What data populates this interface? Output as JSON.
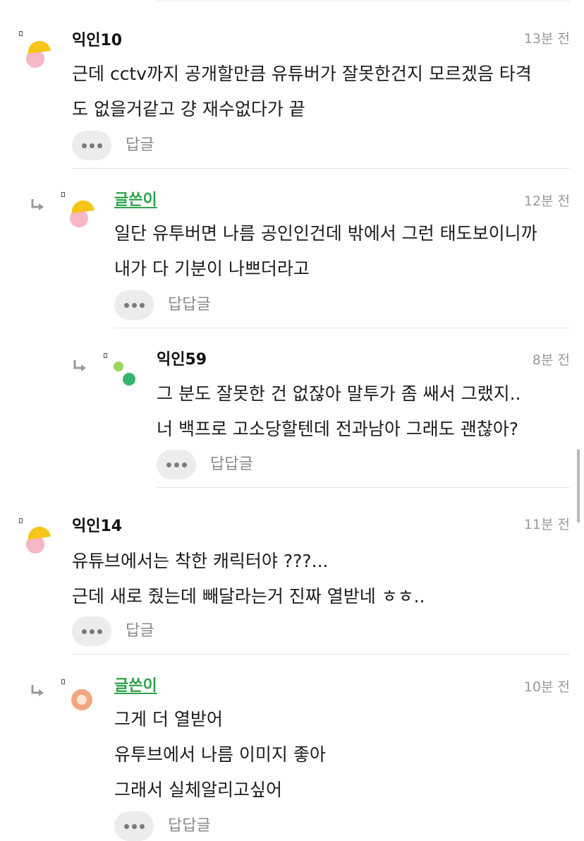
{
  "comments": [
    {
      "author": "익인10",
      "time": "13분 전",
      "lines": [
        "근데 cctv까지 공개할만큼 유튜버가 잘못한건지 모르겠음 타격",
        "도 없을거같고 걍 재수없다가 끝"
      ],
      "reply_label": "답글"
    },
    {
      "author": "글쓴이",
      "time": "12분 전",
      "lines": [
        "일단 유투버면 나름 공인인건데 밖에서 그런 태도보이니까",
        "내가 다 기분이 나쁘더라고"
      ],
      "reply_label": "답답글"
    },
    {
      "author": "익인59",
      "time": "8분 전",
      "lines": [
        "그 분도 잘못한 건 없잖아 말투가 좀 쌔서 그랬지..",
        "너 백프로 고소당할텐데 전과남아 그래도 괜찮아?"
      ],
      "reply_label": "답답글"
    },
    {
      "author": "익인14",
      "time": "11분 전",
      "lines": [
        "유튜브에서는 착한 캐릭터야 ???...",
        "근데 새로 줬는데 빼달라는거 진짜 열받네 ㅎㅎ.."
      ],
      "reply_label": "답글"
    },
    {
      "author": "글쓴이",
      "time": "10분 전",
      "lines": [
        "그게 더 열받어",
        "유투브에서 나름 이미지 좋아",
        "그래서 실체알리고싶어"
      ],
      "reply_label": "답답글"
    }
  ],
  "colors": {
    "op_author": "#2ea24a",
    "avatar_yellow": "#f5c518",
    "avatar_pink": "#f4b8c4",
    "avatar_green_light": "#9bd45a",
    "avatar_green": "#35b56a",
    "avatar_orange": "#f3a77f"
  }
}
